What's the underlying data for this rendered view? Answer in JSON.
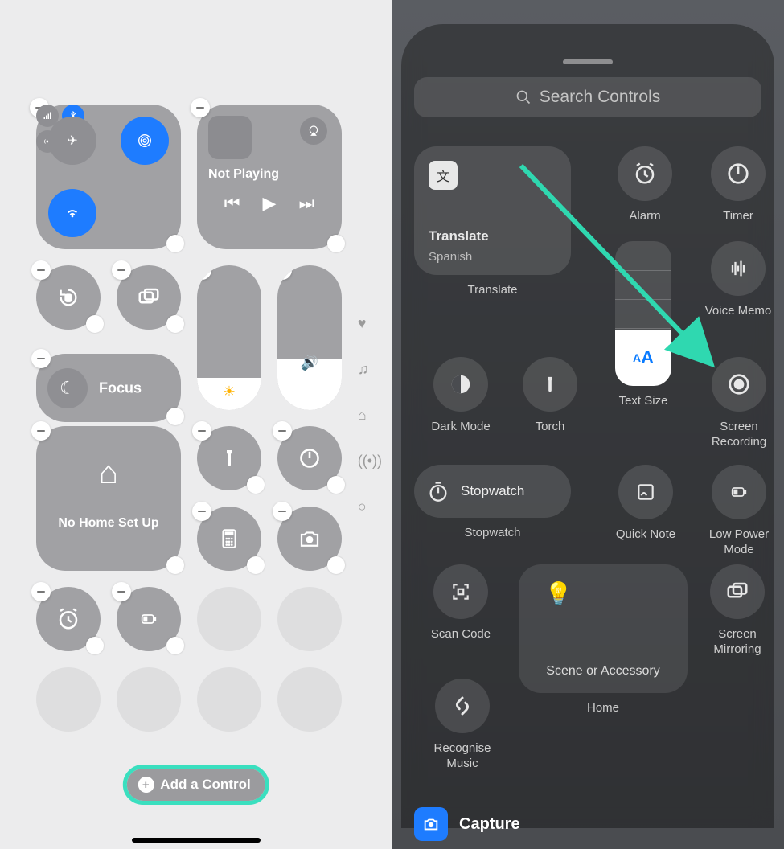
{
  "left": {
    "music": {
      "state": "Not Playing"
    },
    "focus": "Focus",
    "home": "No Home Set Up",
    "add_control": "Add a Control"
  },
  "right": {
    "search_placeholder": "Search Controls",
    "translate": {
      "title": "Translate",
      "sub": "Spanish",
      "caption": "Translate"
    },
    "alarm": "Alarm",
    "timer": "Timer",
    "voice_memo": "Voice Memo",
    "dark_mode": "Dark Mode",
    "torch": "Torch",
    "text_size": "Text Size",
    "screen_recording": "Screen\nRecording",
    "stopwatch": {
      "label": "Stopwatch",
      "caption": "Stopwatch"
    },
    "quick_note": "Quick Note",
    "low_power": "Low Power\nMode",
    "scan": "Scan Code",
    "mirror": "Screen\nMirroring",
    "home_tile": "Scene or Accessory",
    "home_caption": "Home",
    "recognise": "Recognise\nMusic",
    "capture": "Capture"
  }
}
